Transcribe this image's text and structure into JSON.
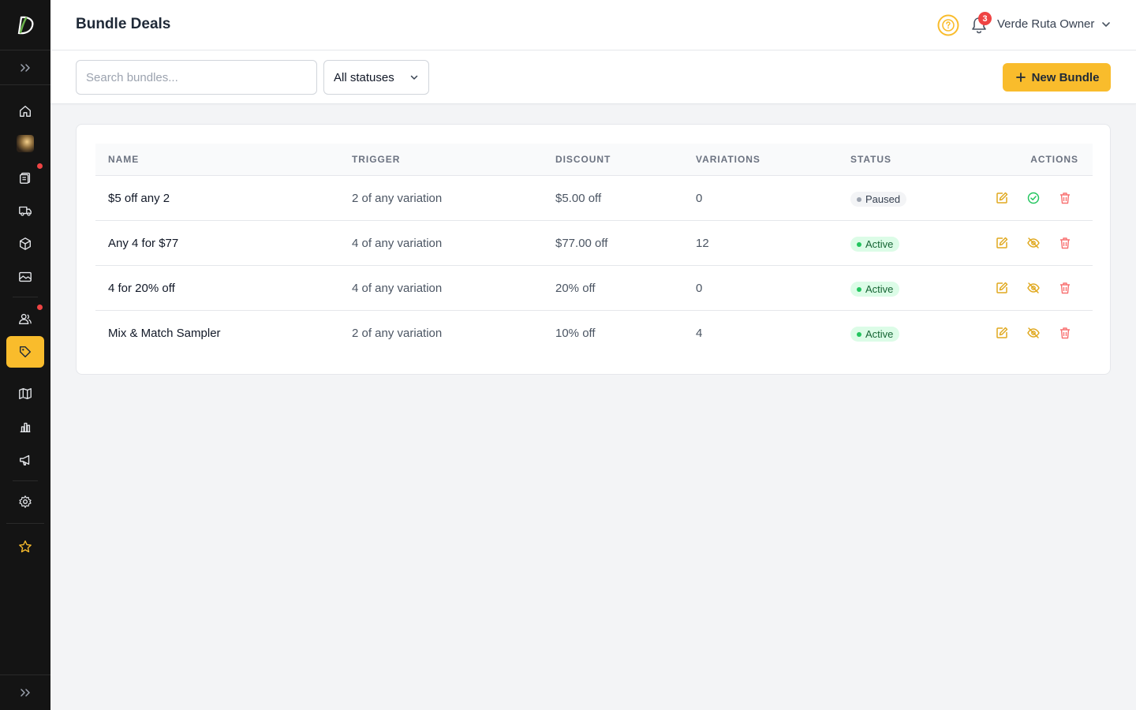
{
  "header": {
    "title": "Bundle Deals",
    "notification_count": "3",
    "user_name": "Verde Ruta Owner"
  },
  "toolbar": {
    "search_placeholder": "Search bundles...",
    "status_filter": "All statuses",
    "new_button_label": "New Bundle"
  },
  "sidebar": {
    "items": [
      {
        "icon": "home-icon",
        "active": false
      },
      {
        "icon": "avatar-image",
        "active": false
      },
      {
        "icon": "clipboard-icon",
        "active": false,
        "notification": true
      },
      {
        "icon": "truck-icon",
        "active": false
      },
      {
        "icon": "box-icon",
        "active": false
      },
      {
        "icon": "image-icon",
        "active": false
      },
      {
        "icon": "users-icon",
        "active": false,
        "notification": true
      },
      {
        "icon": "tag-icon",
        "active": true
      },
      {
        "icon": "map-icon",
        "active": false
      },
      {
        "icon": "chart-icon",
        "active": false
      },
      {
        "icon": "megaphone-icon",
        "active": false
      },
      {
        "icon": "gear-icon",
        "active": false
      },
      {
        "icon": "star-icon",
        "active": false
      }
    ]
  },
  "table": {
    "headers": {
      "name": "NAME",
      "trigger": "TRIGGER",
      "discount": "DISCOUNT",
      "variations": "VARIATIONS",
      "status": "STATUS",
      "actions": "ACTIONS"
    },
    "rows": [
      {
        "name": "$5 off any 2",
        "trigger": "2 of any variation",
        "discount": "$5.00 off",
        "variations": "0",
        "status": "Paused"
      },
      {
        "name": "Any 4 for $77",
        "trigger": "4 of any variation",
        "discount": "$77.00 off",
        "variations": "12",
        "status": "Active"
      },
      {
        "name": "4 for 20% off",
        "trigger": "4 of any variation",
        "discount": "20% off",
        "variations": "0",
        "status": "Active"
      },
      {
        "name": "Mix & Match Sampler",
        "trigger": "2 of any variation",
        "discount": "10% off",
        "variations": "4",
        "status": "Active"
      }
    ]
  },
  "colors": {
    "accent": "#f9bc2c",
    "sidebar_bg": "#141414",
    "active_badge_bg": "#dcfce7",
    "active_badge_text": "#166534",
    "danger": "#ef4444",
    "success": "#22c55e"
  }
}
